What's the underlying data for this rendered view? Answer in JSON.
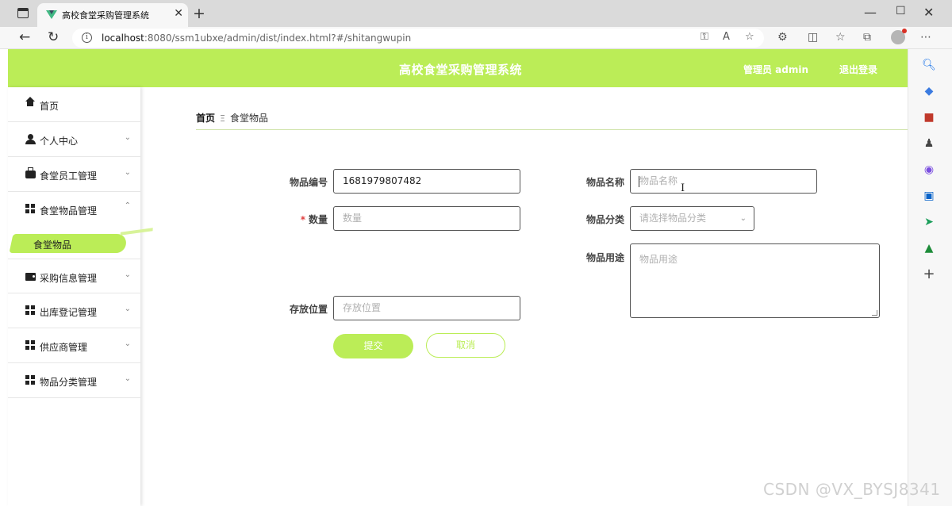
{
  "browser": {
    "tab_title": "高校食堂采购管理系统",
    "url_host": "localhost",
    "url_rest": ":8080/ssm1ubxe/admin/dist/index.html?#/shitangwupin",
    "icons": [
      "sidebar-toggle-icon",
      "vue-logo-icon",
      "close-icon",
      "plus-icon",
      "minimize-icon",
      "maximize-icon",
      "back-icon",
      "refresh-icon",
      "info-icon",
      "key-icon",
      "read-aloud-icon",
      "favorite-add-icon",
      "extensions-icon",
      "split-screen-icon",
      "favorites-icon",
      "collections-icon",
      "profile-icon",
      "more-icon"
    ]
  },
  "header": {
    "title": "高校食堂采购管理系统",
    "admin": "管理员 admin",
    "logout": "退出登录",
    "color": "#bbed57"
  },
  "sidebar": {
    "items": [
      {
        "label": "首页",
        "icon": "home-icon"
      },
      {
        "label": "个人中心",
        "icon": "user-icon"
      },
      {
        "label": "食堂员工管理",
        "icon": "briefcase-icon"
      },
      {
        "label": "食堂物品管理",
        "icon": "grid-icon"
      },
      {
        "label": "采购信息管理",
        "icon": "wallet-icon"
      },
      {
        "label": "出库登记管理",
        "icon": "grid-icon"
      },
      {
        "label": "供应商管理",
        "icon": "grid-icon"
      },
      {
        "label": "物品分类管理",
        "icon": "grid-icon"
      }
    ],
    "active_sub": "食堂物品"
  },
  "breadcrumb": {
    "home": "首页",
    "current": "食堂物品"
  },
  "form": {
    "code_label": "物品编号",
    "code_value": "1681979807482",
    "name_label": "物品名称",
    "name_placeholder": "物品名称",
    "qty_required": "*",
    "qty_label": "数量",
    "qty_placeholder": "数量",
    "category_label": "物品分类",
    "category_placeholder": "请选择物品分类",
    "usage_label": "物品用途",
    "usage_placeholder": "物品用途",
    "location_label": "存放位置",
    "location_placeholder": "存放位置",
    "submit": "提交",
    "cancel": "取消"
  },
  "watermark": "CSDN @VX_BYSJ8341"
}
